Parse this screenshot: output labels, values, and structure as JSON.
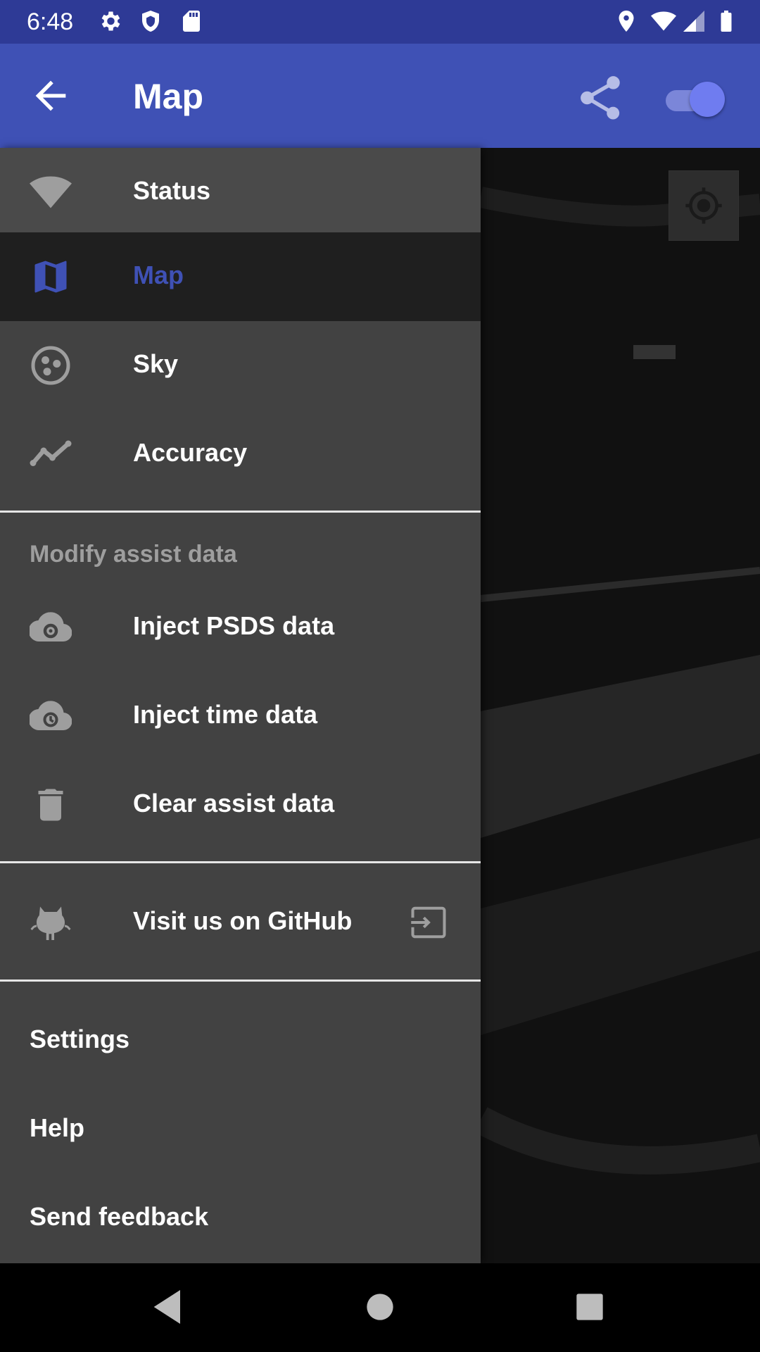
{
  "status_bar": {
    "time": "6:48",
    "icons": [
      "settings-icon",
      "shield-icon",
      "sd-card-icon",
      "location-icon",
      "wifi-icon",
      "signal-icon",
      "battery-icon"
    ]
  },
  "app_bar": {
    "title": "Map",
    "back_icon": "arrow-back-icon",
    "share_icon": "share-icon",
    "toggle_state": "on",
    "color": "#3f51b5"
  },
  "drawer": {
    "nav_items": [
      {
        "label": "Status",
        "icon": "wifi-icon"
      },
      {
        "label": "Map",
        "icon": "map-icon",
        "selected": true
      },
      {
        "label": "Sky",
        "icon": "satellite-icon"
      },
      {
        "label": "Accuracy",
        "icon": "chart-line-icon"
      }
    ],
    "section_header": "Modify assist data",
    "assist_items": [
      {
        "label": "Inject PSDS data",
        "icon": "cloud-gear-icon"
      },
      {
        "label": "Inject time data",
        "icon": "cloud-clock-icon"
      },
      {
        "label": "Clear assist data",
        "icon": "trash-icon"
      }
    ],
    "github_item": {
      "label": "Visit us on GitHub",
      "icon": "github-icon",
      "trailing_icon": "open-external-icon"
    },
    "footer_items": [
      {
        "label": "Settings"
      },
      {
        "label": "Help"
      },
      {
        "label": "Send feedback"
      }
    ],
    "accent_color": "#3f51b5"
  },
  "nav_bar": {
    "buttons": [
      "back-triangle-icon",
      "home-circle-icon",
      "recents-square-icon"
    ]
  }
}
